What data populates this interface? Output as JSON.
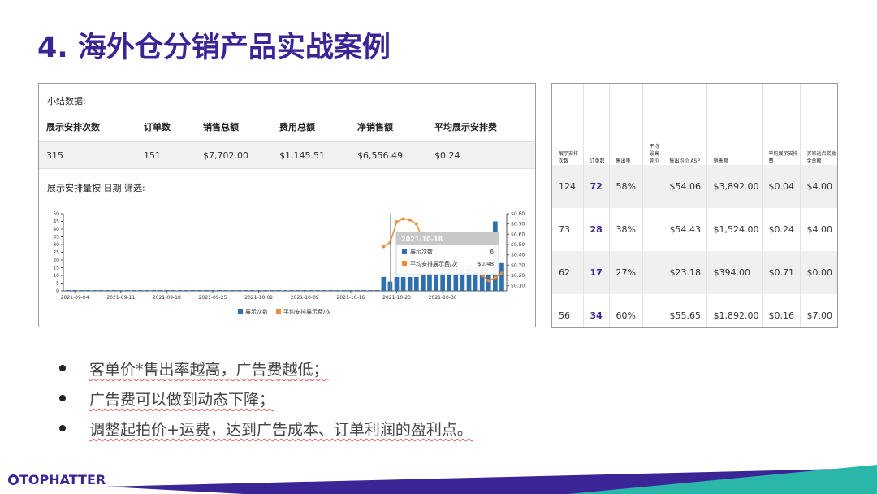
{
  "title": "4. 海外仓分销产品实战案例",
  "summary": {
    "title": "小结数据:",
    "headers": [
      "展示安排次数",
      "订单数",
      "销售总额",
      "费用总额",
      "净销售额",
      "平均展示安排费"
    ],
    "values": [
      "315",
      "151",
      "$7,702.00",
      "$1,145.51",
      "$6,556.49",
      "$0.24"
    ]
  },
  "chart_title": "展示安排量按 日期 筛选:",
  "chart_data": {
    "type": "bar",
    "x_ticks": [
      "2021-09-04",
      "2021-09-11",
      "2021-09-18",
      "2021-09-25",
      "2021-10-02",
      "2021-10-09",
      "2021-10-16",
      "2021-10-23",
      "2021-10-30"
    ],
    "left_ticks": [
      "0",
      "5",
      "10",
      "15",
      "20",
      "25",
      "30",
      "35",
      "40",
      "45",
      "50"
    ],
    "right_ticks": [
      "$0.10",
      "$0.20",
      "$0.30",
      "$0.40",
      "$0.50",
      "$0.60",
      "$0.70",
      "$0.80"
    ],
    "ylim_left": [
      0,
      50
    ],
    "ylim_right": [
      0.05,
      0.8
    ],
    "series": [
      {
        "name": "展示次数",
        "type": "bar",
        "color": "#2f6fae",
        "values": [
          0.5,
          0.5,
          0.5,
          0.5,
          0.5,
          0.5,
          0.5,
          0.5,
          0.5,
          0.5,
          0.5,
          0.5,
          0.5,
          0.5,
          0.5,
          0.5,
          0.5,
          0.5,
          0.5,
          0.5,
          0.5,
          0.5,
          0.5,
          0.5,
          0.5,
          0.5,
          0.5,
          0.5,
          0.5,
          0.5,
          0.5,
          0.5,
          0.5,
          0.5,
          0.5,
          0.5,
          0.5,
          0.5,
          0.5,
          0.5,
          0.5,
          0.5,
          0.5,
          0.5,
          0.5,
          0.5,
          0.5,
          0.5,
          9,
          6,
          9,
          9,
          9,
          9,
          11,
          13,
          15,
          17,
          18,
          18,
          16,
          17,
          15,
          18,
          16,
          45,
          18
        ]
      },
      {
        "name": "平均安排展示费/次",
        "type": "line",
        "color": "#f08c3a",
        "values": [
          null,
          null,
          null,
          null,
          null,
          null,
          null,
          null,
          null,
          null,
          null,
          null,
          null,
          null,
          null,
          null,
          null,
          null,
          null,
          null,
          null,
          null,
          null,
          null,
          null,
          null,
          null,
          null,
          null,
          null,
          null,
          null,
          null,
          null,
          null,
          null,
          null,
          null,
          null,
          null,
          null,
          null,
          null,
          null,
          null,
          null,
          null,
          null,
          0.48,
          0.52,
          0.72,
          0.75,
          0.74,
          0.7,
          0.55,
          0.48,
          0.4,
          0.35,
          0.3,
          0.28,
          0.3,
          0.28,
          0.25,
          0.2,
          0.15,
          0.18,
          0.22
        ]
      }
    ],
    "tooltip": {
      "date": "2021-10-18",
      "rows": [
        {
          "label": "展示次数",
          "value": "6"
        },
        {
          "label": "平均安排展示费/次",
          "value": "$0.48"
        }
      ]
    }
  },
  "right_table": {
    "headers": [
      "展示安排次数",
      "订单数",
      "售出率",
      "平均最高竞价",
      "售出均价 ASP",
      "销售额",
      "平均展示安排费",
      "买家返点奖励金总额"
    ],
    "rows": [
      [
        "124",
        "72",
        "58%",
        "",
        "$54.06",
        "$3,892.00",
        "$0.04",
        "$4.00"
      ],
      [
        "73",
        "28",
        "38%",
        "",
        "$54.43",
        "$1,524.00",
        "$0.24",
        "$4.00"
      ],
      [
        "62",
        "17",
        "27%",
        "",
        "$23.18",
        "$394.00",
        "$0.71",
        "$0.00"
      ],
      [
        "56",
        "34",
        "60%",
        "",
        "$55.65",
        "$1,892.00",
        "$0.16",
        "$7.00"
      ]
    ]
  },
  "bullets": [
    "客单价*售出率越高，广告费越低；",
    "广告费可以做到动态下降；",
    "调整起拍价+运费，达到广告成本、订单利润的盈利点。"
  ],
  "footer": {
    "brand": "TOPHATTER",
    "colors": {
      "purple": "#3b2596",
      "teal": "#2ab7a9"
    }
  }
}
